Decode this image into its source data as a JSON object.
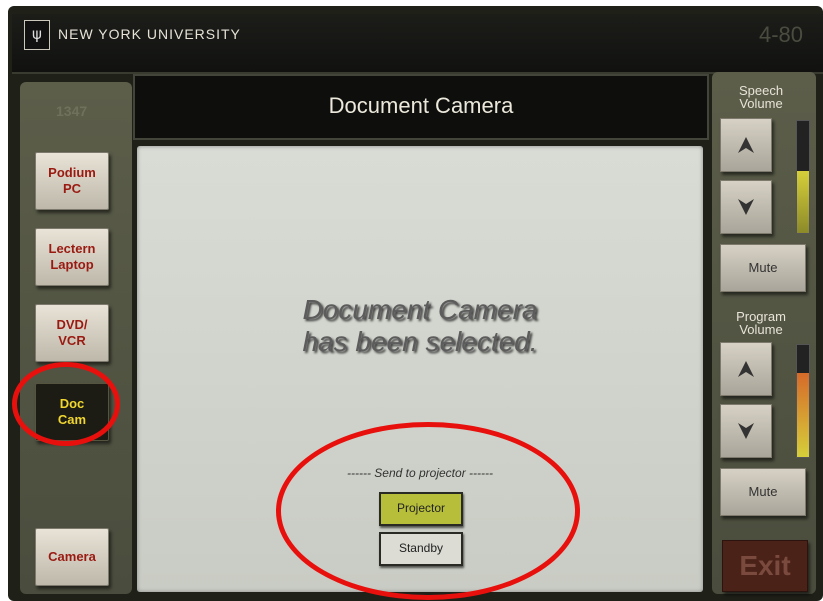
{
  "header": {
    "logo_glyph": "ψ",
    "university": "NEW YORK UNIVERSITY",
    "room_number": "4-80"
  },
  "sidebar": {
    "ghost_label": "1347",
    "sources": [
      {
        "label": "Podium\nPC",
        "active": false
      },
      {
        "label": "Lectern\nLaptop",
        "active": false
      },
      {
        "label": "DVD/\nVCR",
        "active": false
      },
      {
        "label": "Doc\nCam",
        "active": true
      },
      {
        "label": "Camera",
        "active": false
      }
    ]
  },
  "main": {
    "title": "Document Camera",
    "message_line1": "Document Camera",
    "message_line2": "has been selected.",
    "send_label": "------ Send to projector ------",
    "projector_label": "Projector",
    "standby_label": "Standby"
  },
  "volume": {
    "speech_label": "Speech\nVolume",
    "speech_level": 0.55,
    "speech_mute": "Mute",
    "program_label": "Program\nVolume",
    "program_level": 0.75,
    "program_mute": "Mute",
    "up_icon": "arrow-up-icon",
    "down_icon": "arrow-down-icon"
  },
  "exit_label": "Exit",
  "colors": {
    "active_source_text": "#f0d62e",
    "projector_button": "#b7bf3a",
    "annotation_red": "#e8100d",
    "speech_meter": "#d6cf3a",
    "program_meter": "#d66a2a"
  }
}
